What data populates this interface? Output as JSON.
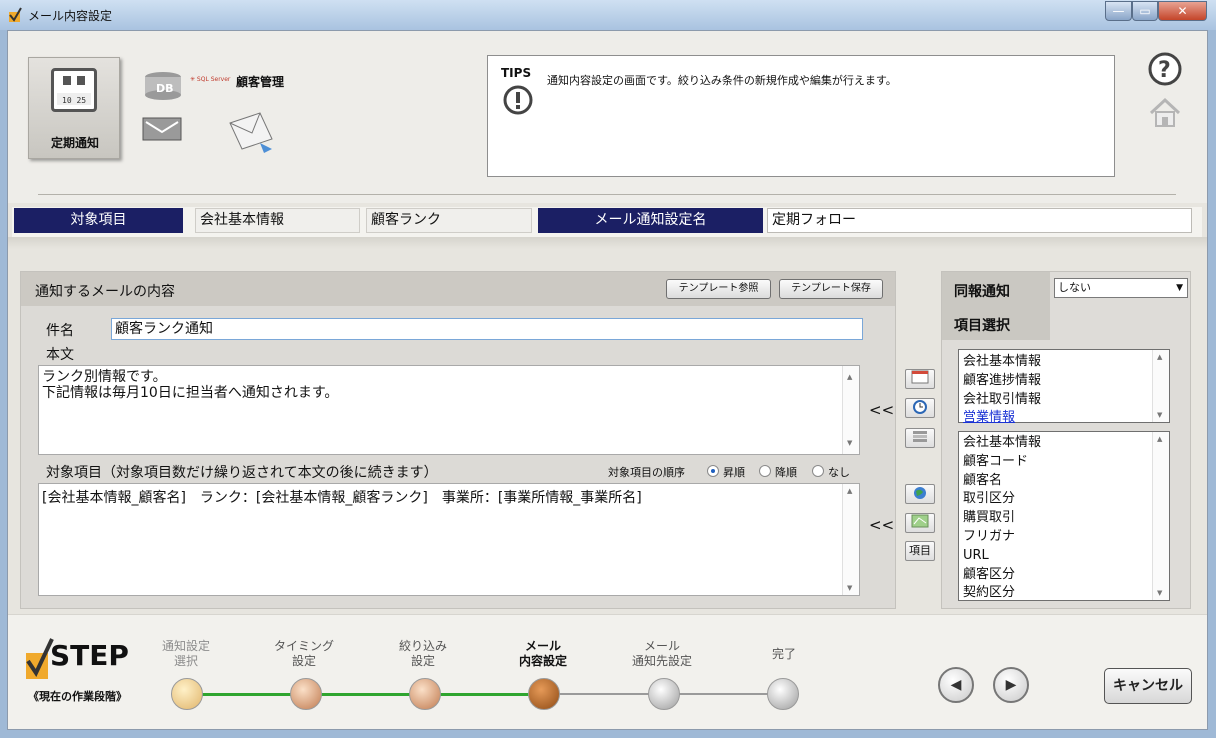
{
  "window": {
    "title": "メール内容設定"
  },
  "header": {
    "mode_tile_label": "定期通知",
    "customer_label": "顧客管理",
    "tips_title": "TIPS",
    "tips_text": "通知内容設定の画面です。絞り込み条件の新規作成や編集が行えます。"
  },
  "items_bar": {
    "label": "対象項目",
    "field_1": "会社基本情報",
    "field_2": "顧客ランク",
    "notify_name_label": "メール通知設定名",
    "notify_name_value": "定期フォロー"
  },
  "mail_panel": {
    "title": "通知するメールの内容",
    "template_ref_label": "テンプレート参照",
    "template_save_label": "テンプレート保存",
    "subject_label": "件名",
    "subject_value": "顧客ランク通知",
    "body_label": "本文",
    "body_lines": [
      "ランク別情報です。",
      "下記情報は毎月10日に担当者へ通知されます。"
    ],
    "target_label": "対象項目（対象項目数だけ繰り返されて本文の後に続きます）",
    "order_label": "対象項目の順序",
    "order_options": [
      "昇順",
      "降順",
      "なし"
    ],
    "order_selected": "昇順",
    "target_value": "[会社基本情報_顧客名]　ランク：[会社基本情報_顧客ランク]　事業所：[事業所情報_事業所名]",
    "insert_arrow": "<<",
    "item_button_label": "項目"
  },
  "right_panel": {
    "cc_label": "同報通知",
    "cc_select_value": "しない",
    "item_select_label": "項目選択",
    "categories": [
      "会社基本情報",
      "顧客進捗情報",
      "会社取引情報",
      "営業情報"
    ],
    "fields": [
      "会社基本情報",
      "顧客コード",
      "顧客名",
      "取引区分",
      "購買取引",
      "フリガナ",
      "URL",
      "顧客区分",
      "契約区分"
    ]
  },
  "step_bar": {
    "logo_text": "STEP",
    "subtitle": "《現在の作業段階》",
    "steps": [
      {
        "line1": "通知設定",
        "line2": "選択",
        "status": "done"
      },
      {
        "line1": "タイミング",
        "line2": "設定",
        "status": "done"
      },
      {
        "line1": "絞り込み",
        "line2": "設定",
        "status": "done"
      },
      {
        "line1": "メール",
        "line2": "内容設定",
        "status": "current"
      },
      {
        "line1": "メール",
        "line2": "通知先設定",
        "status": "todo"
      },
      {
        "line1": "完了",
        "line2": "",
        "status": "todo"
      }
    ],
    "cancel_label": "キャンセル"
  },
  "colors": {
    "navy": "#1b1f64",
    "link": "#1a32d4",
    "progress_line": "#2fa52f"
  }
}
